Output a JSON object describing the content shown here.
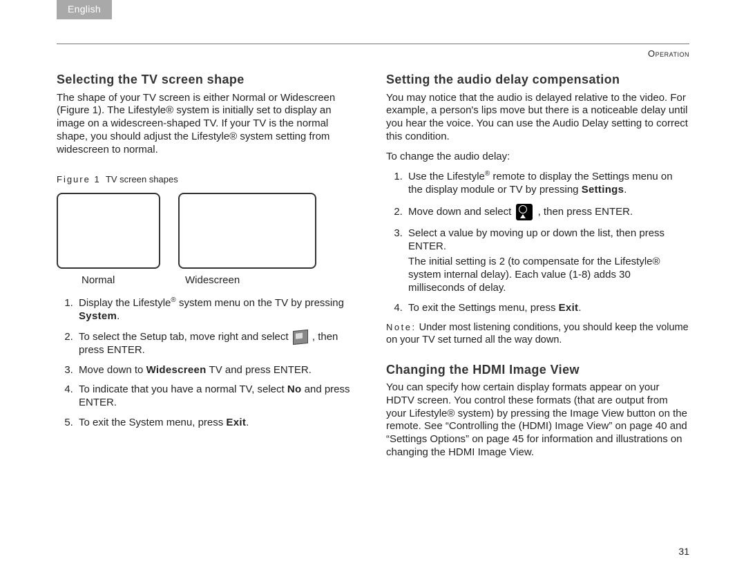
{
  "langTab": "English",
  "sectionLabel": "Operation",
  "pageNumber": "31",
  "left": {
    "h1": "Selecting the TV screen shape",
    "intro": "The shape of your TV screen is either Normal or Widescreen (Figure 1). The Lifestyle® system is initially set to display an image on a widescreen-shaped TV. If your TV is the normal shape, you should adjust the Lifestyle® system setting from widescreen to normal.",
    "figLabel": "Figure 1",
    "figCaption": "TV screen shapes",
    "shapeNormal": "Normal",
    "shapeWide": "Widescreen",
    "steps": {
      "s1a": "Display the Lifestyle",
      "s1b": " system menu on the TV by pressing ",
      "s1c": "System",
      "s1d": ".",
      "s2a": "To select the Setup tab, move right and select ",
      "s2b": ", then press ENTER.",
      "s3a": "Move down to ",
      "s3b": "Widescreen",
      "s3c": " TV and press ENTER.",
      "s4a": "To indicate that you have a normal TV, select ",
      "s4b": "No",
      "s4c": " and press ENTER.",
      "s5a": "To exit the System menu, press ",
      "s5b": "Exit",
      "s5c": "."
    }
  },
  "right": {
    "h1": "Setting the audio delay compensation",
    "intro": "You may notice that the audio is delayed relative to the video. For example, a person's lips move but there is a noticeable delay until you hear the voice. You can use the Audio Delay setting to correct this condition.",
    "lead": "To change the audio delay:",
    "steps": {
      "s1a": "Use the Lifestyle",
      "s1b": " remote to display the Settings menu on the display module or TV by pressing ",
      "s1c": "Settings",
      "s1d": ".",
      "s2a": "Move down and select ",
      "s2b": ", then press ENTER.",
      "s3": "Select a value by moving up or down the list, then press ENTER.",
      "s3sub": "The initial setting is 2 (to compensate for the Lifestyle® system internal delay). Each value (1-8) adds 30 milliseconds of delay.",
      "s4a": "To exit the Settings menu, press ",
      "s4b": "Exit",
      "s4c": "."
    },
    "noteLabel": "Note:",
    "note": " Under most listening conditions, you should keep the volume on your TV set turned all the way down.",
    "h2": "Changing the HDMI Image View",
    "para2": "You can specify how certain display formats appear on your HDTV screen. You control these formats (that are output from your Lifestyle® system) by pressing the Image View button on the remote. See “Controlling the (HDMI) Image View” on page 40 and “Settings Options” on page 45 for information and illustrations on changing the HDMI Image View."
  }
}
